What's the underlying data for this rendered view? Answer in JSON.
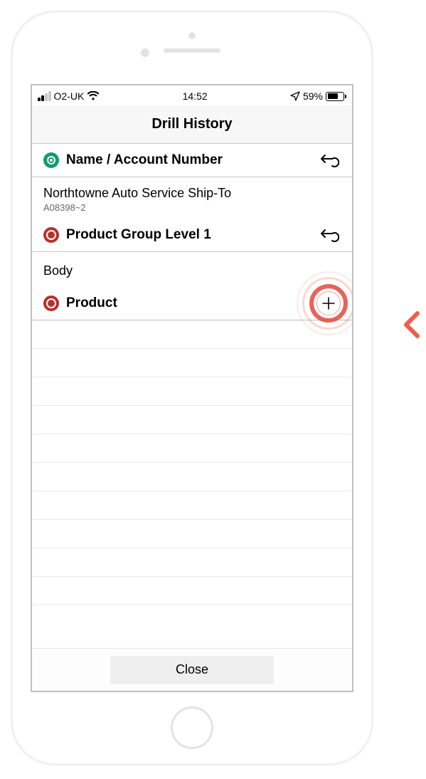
{
  "statusbar": {
    "carrier": "O2-UK",
    "time": "14:52",
    "battery_pct": "59%"
  },
  "nav": {
    "title": "Drill History"
  },
  "rows": {
    "account_header": "Name / Account Number",
    "account_name": "Northtowne Auto Service Ship-To",
    "account_code": "A08398~2",
    "group_header": "Product Group Level 1",
    "group_value": "Body",
    "product_header": "Product"
  },
  "bottom": {
    "close": "Close"
  },
  "colors": {
    "accent_red": "#b9302a",
    "accent_green": "#0e9f6e",
    "highlight": "#f35c4b"
  }
}
